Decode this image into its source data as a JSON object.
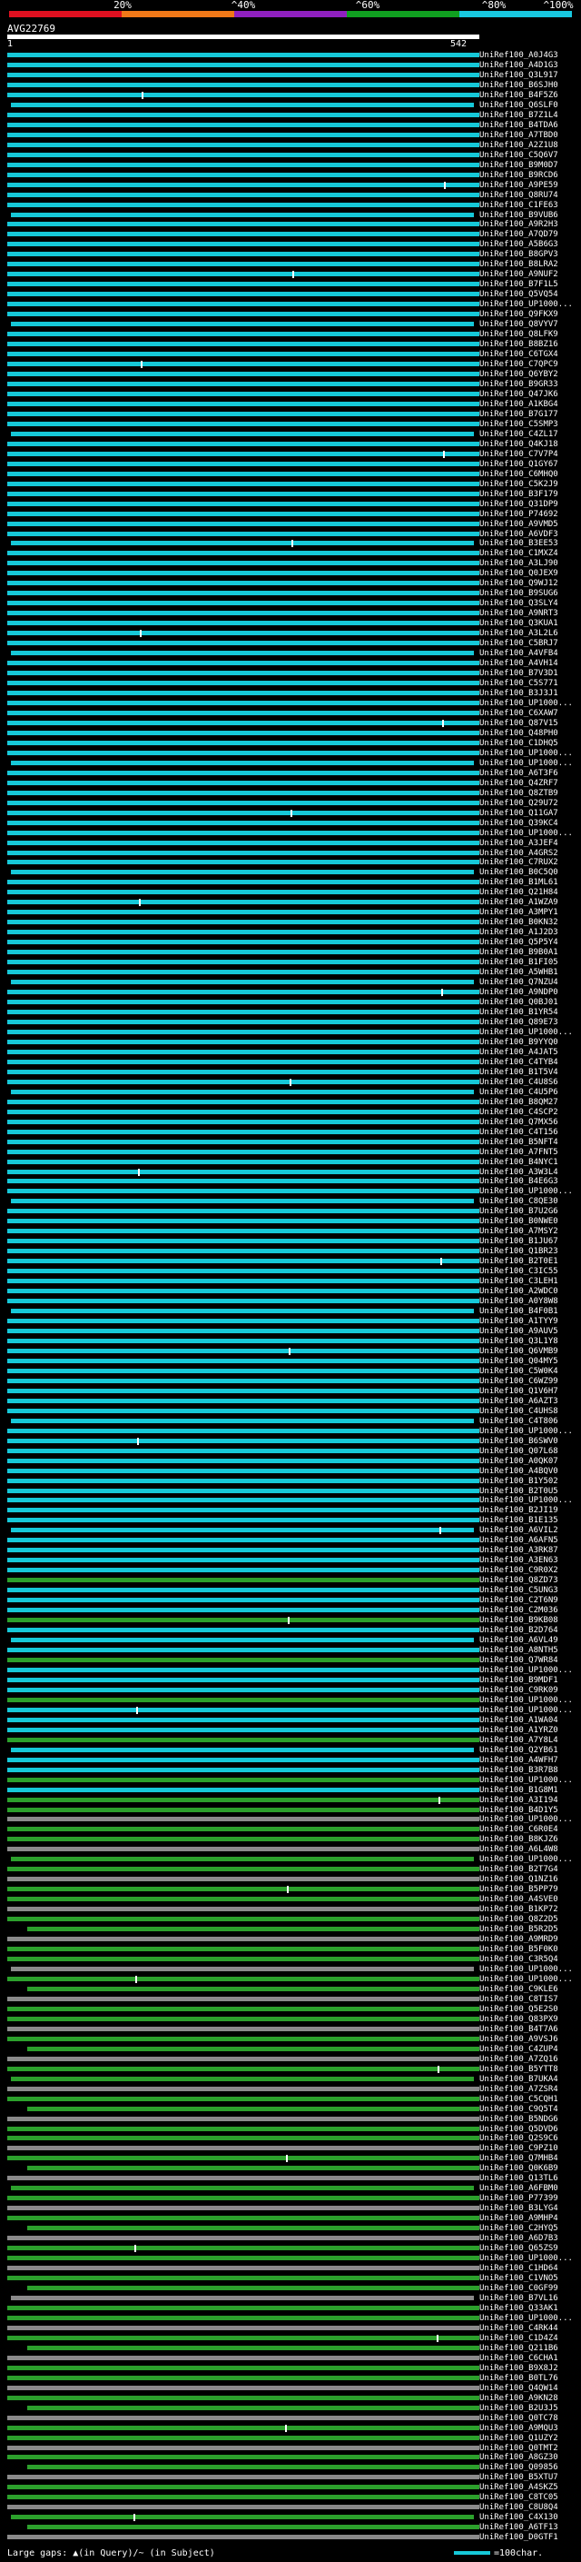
{
  "query": {
    "id": "AVG22769",
    "start": "1",
    "end": "542"
  },
  "scale": {
    "labels": [
      "20%",
      "^40%",
      "^60%",
      "^80%",
      "^100%"
    ],
    "colors": [
      "#e01020",
      "#f07818",
      "#9020c0",
      "#10a020",
      "#18c8e0"
    ]
  },
  "colors": {
    "cyan": "#16c8d8",
    "green": "#2ca02c",
    "gray": "#8a8a8a"
  },
  "hits": [
    "UniRef100_A0J4G3",
    "UniRef100_A4D1G3",
    "UniRef100_Q3L917",
    "UniRef100_B6SJH0",
    "UniRef100_B4F5Z6",
    "UniRef100_Q6SLF0",
    "UniRef100_B7Z1L4",
    "UniRef100_B4TDA6",
    "UniRef100_A7TBD0",
    "UniRef100_A2Z1U8",
    "UniRef100_C5Q6V7",
    "UniRef100_B9M0D7",
    "UniRef100_B9RCD6",
    "UniRef100_A9PE59",
    "UniRef100_Q8RU74",
    "UniRef100_C1FE63",
    "UniRef100_B9VUB6",
    "UniRef100_A9R2H3",
    "UniRef100_A7QD79",
    "UniRef100_A5B6G3",
    "UniRef100_B8GPV3",
    "UniRef100_B8LRA2",
    "UniRef100_A9NUF2",
    "UniRef100_B7F1L5",
    "UniRef100_Q5VQ54",
    "UniRef100_UP1000...",
    "UniRef100_Q9FKX9",
    "UniRef100_Q8VYV7",
    "UniRef100_Q8LFK9",
    "UniRef100_B8BZ16",
    "UniRef100_C6TGX4",
    "UniRef100_C7QPC9",
    "UniRef100_Q6YBY2",
    "UniRef100_B9GR33",
    "UniRef100_Q47JK6",
    "UniRef100_A1KBG4",
    "UniRef100_B7G177",
    "UniRef100_C5SMP3",
    "UniRef100_C4ZL17",
    "UniRef100_Q4KJ18",
    "UniRef100_C7V7P4",
    "UniRef100_Q1GY67",
    "UniRef100_C6MHQ0",
    "UniRef100_C5K2J9",
    "UniRef100_B3F179",
    "UniRef100_Q31DP9",
    "UniRef100_P74692",
    "UniRef100_A9VMD5",
    "UniRef100_A6VDF3",
    "UniRef100_B3EE53",
    "UniRef100_C1MXZ4",
    "UniRef100_A3LJ90",
    "UniRef100_Q0JEX9",
    "UniRef100_Q9WJ12",
    "UniRef100_B9SUG6",
    "UniRef100_Q3SLY4",
    "UniRef100_A9NRT3",
    "UniRef100_Q3KUA1",
    "UniRef100_A3L2L6",
    "UniRef100_C5BRJ7",
    "UniRef100_A4VFB4",
    "UniRef100_A4VH14",
    "UniRef100_B7V3D1",
    "UniRef100_C5S771",
    "UniRef100_B3J3J1",
    "UniRef100_UP1000...",
    "UniRef100_C6XAW7",
    "UniRef100_Q87V15",
    "UniRef100_Q48PH0",
    "UniRef100_C1DHQ5",
    "UniRef100_UP1000...",
    "UniRef100_UP1000...",
    "UniRef100_A6T3F6",
    "UniRef100_Q4ZRF7",
    "UniRef100_Q8ZTB9",
    "UniRef100_Q29U72",
    "UniRef100_Q11GA7",
    "UniRef100_Q39KC4",
    "UniRef100_UP1000...",
    "UniRef100_A3JEF4",
    "UniRef100_A4GRS2",
    "UniRef100_C7RUX2",
    "UniRef100_B0C5Q0",
    "UniRef100_B1ML61",
    "UniRef100_Q21H84",
    "UniRef100_A1WZA9",
    "UniRef100_A3MPY1",
    "UniRef100_B0KN32",
    "UniRef100_A1J2D3",
    "UniRef100_Q5P5Y4",
    "UniRef100_B9B0A1",
    "UniRef100_B1FI05",
    "UniRef100_A5WHB1",
    "UniRef100_Q7NZU4",
    "UniRef100_A9NDP0",
    "UniRef100_Q0BJ01",
    "UniRef100_B1YR54",
    "UniRef100_Q89E73",
    "UniRef100_UP1000...",
    "UniRef100_B9YYQ0",
    "UniRef100_A4JAT5",
    "UniRef100_C4TYB4",
    "UniRef100_B1T5V4",
    "UniRef100_C4U8S6",
    "UniRef100_C4U5P6",
    "UniRef100_B8QM27",
    "UniRef100_C4SCP2",
    "UniRef100_Q7MX56",
    "UniRef100_C4T156",
    "UniRef100_B5NFT4",
    "UniRef100_A7FNT5",
    "UniRef100_B4NYC1",
    "UniRef100_A3W3L4",
    "UniRef100_B4E6G3",
    "UniRef100_UP1000...",
    "UniRef100_C8QE30",
    "UniRef100_B7U2G6",
    "UniRef100_B0NWE0",
    "UniRef100_A7MSY2",
    "UniRef100_B1JU67",
    "UniRef100_Q1BR23",
    "UniRef100_B2T0E1",
    "UniRef100_C3IC55",
    "UniRef100_C3LEH1",
    "UniRef100_A2WDC0",
    "UniRef100_A0Y8W8",
    "UniRef100_B4F0B1",
    "UniRef100_A1TYY9",
    "UniRef100_A9AUV5",
    "UniRef100_Q3L1Y8",
    "UniRef100_Q6VMB9",
    "UniRef100_Q04MY5",
    "UniRef100_C5W0K4",
    "UniRef100_C6WZ99",
    "UniRef100_Q1V6H7",
    "UniRef100_A6AZT3",
    "UniRef100_C4UHS8",
    "UniRef100_C4T806",
    "UniRef100_UP1000...",
    "UniRef100_B6SWV0",
    "UniRef100_Q07L68",
    "UniRef100_A0QK07",
    "UniRef100_A4BQV0",
    "UniRef100_B1Y502",
    "UniRef100_B2T0U5",
    "UniRef100_UP1000...",
    "UniRef100_B2JI19",
    "UniRef100_B1E135",
    "UniRef100_A6VIL2",
    "UniRef100_A6AFN5",
    "UniRef100_A3RK87",
    "UniRef100_A3EN63",
    "UniRef100_C9R0X2",
    "UniRef100_Q8ZD73",
    "UniRef100_C5UNG3",
    "UniRef100_C2T6N9",
    "UniRef100_C2M036",
    "UniRef100_B9KB08",
    "UniRef100_B2D764",
    "UniRef100_A6VL49",
    "UniRef100_A8NTH5",
    "UniRef100_Q7WR84",
    "UniRef100_UP1000...",
    "UniRef100_B9MDF1",
    "UniRef100_C9RK09",
    "UniRef100_UP1000...",
    "UniRef100_UP1000...",
    "UniRef100_A1WA04",
    "UniRef100_A1YRZ0",
    "UniRef100_A7Y8L4",
    "UniRef100_Q2YB61",
    "UniRef100_A4WFH7",
    "UniRef100_B3R7B8",
    "UniRef100_UP1000...",
    "UniRef100_B1G8M1",
    "UniRef100_A3I194",
    "UniRef100_B4D1Y5",
    "UniRef100_UP1000...",
    "UniRef100_C6R0E4",
    "UniRef100_B8KJZ6",
    "UniRef100_A6L4W8",
    "UniRef100_UP1000...",
    "UniRef100_B2T7G4",
    "UniRef100_Q1NZ16",
    "UniRef100_B5PP79",
    "UniRef100_A4SVE0",
    "UniRef100_B1KP72",
    "UniRef100_Q8Z2D5",
    "UniRef100_B5R2D5",
    "UniRef100_A9MRD9",
    "UniRef100_B5F0K0",
    "UniRef100_C3R5Q4",
    "UniRef100_UP1000...",
    "UniRef100_UP1000...",
    "UniRef100_C9KLE6",
    "UniRef100_C8TIS7",
    "UniRef100_Q5E2S0",
    "UniRef100_Q83PX9",
    "UniRef100_B4T7A6",
    "UniRef100_A9VSJ6",
    "UniRef100_C4ZUP4",
    "UniRef100_A7ZQ16",
    "UniRef100_B5YTT8",
    "UniRef100_B7UKA4",
    "UniRef100_A7ZSR4",
    "UniRef100_C5CQH1",
    "UniRef100_C9Q5T4",
    "UniRef100_B5NDG6",
    "UniRef100_Q5DVD6",
    "UniRef100_Q2S9C6",
    "UniRef100_C9PZ10",
    "UniRef100_Q7MHB4",
    "UniRef100_Q0K6B9",
    "UniRef100_Q13TL6",
    "UniRef100_A6FBM0",
    "UniRef100_P77399",
    "UniRef100_B3LYG4",
    "UniRef100_A9MHP4",
    "UniRef100_C2HYQ5",
    "UniRef100_A6D7B3",
    "UniRef100_Q65ZS9",
    "UniRef100_UP1000...",
    "UniRef100_C1HD64",
    "UniRef100_C1VNO5",
    "UniRef100_C0GF99",
    "UniRef100_B7VL16",
    "UniRef100_Q33AK1",
    "UniRef100_UP1000...",
    "UniRef100_C4RK44",
    "UniRef100_C1D4Z4",
    "UniRef100_Q211B6",
    "UniRef100_C6CHA1",
    "UniRef100_B9X8J2",
    "UniRef100_B0TL76",
    "UniRef100_Q4QW14",
    "UniRef100_A9KN28",
    "UniRef100_B2U3J5",
    "UniRef100_Q0TC78",
    "UniRef100_A9MQU3",
    "UniRef100_Q1UZY2",
    "UniRef100_Q0TMT2",
    "UniRef100_A8GZ30",
    "UniRef100_Q09856",
    "UniRef100_B5XTU7",
    "UniRef100_A4SKZ5",
    "UniRef100_C8TC05",
    "UniRef100_C8U8Q4",
    "UniRef100_C4X130",
    "UniRef100_A6TF13",
    "UniRef100_D0GTF1"
  ],
  "footer": {
    "legend_left": "Large gaps: ▲(in Query)/~ (in Subject)",
    "legend_right": "=100char."
  }
}
